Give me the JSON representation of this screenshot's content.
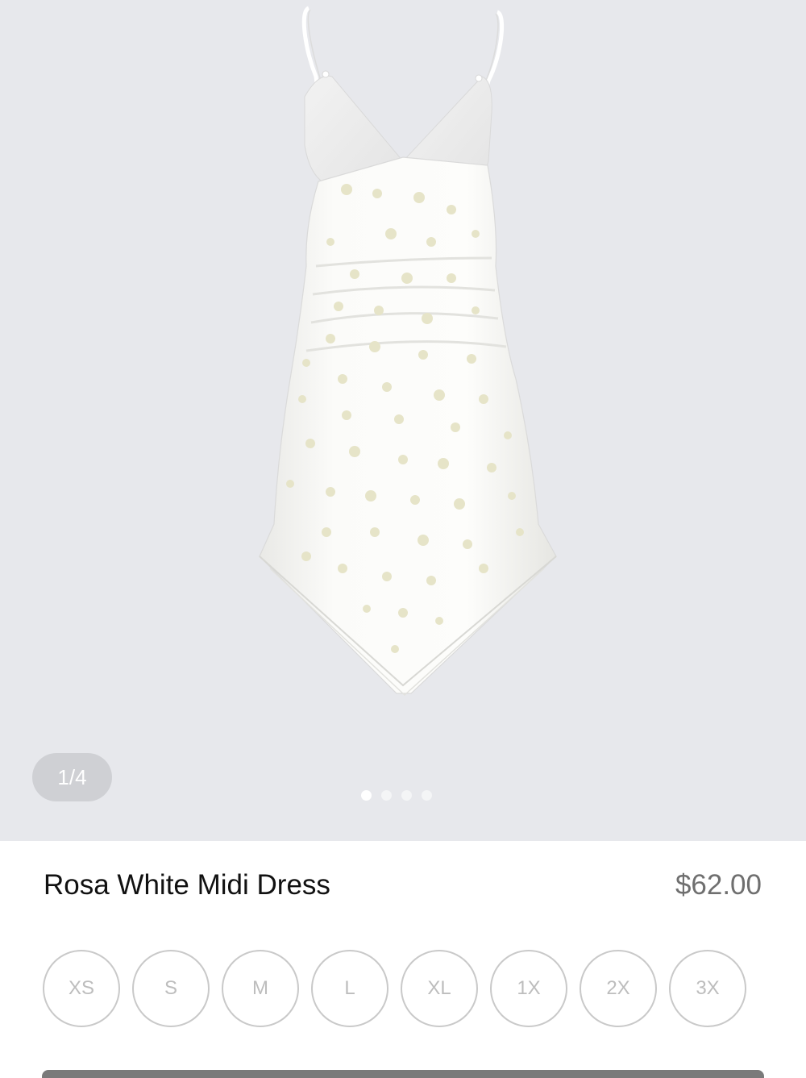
{
  "gallery": {
    "image_counter": "1/4",
    "total_images": 4,
    "active_index": 0
  },
  "product": {
    "title": "Rosa White Midi Dress",
    "price": "$62.00"
  },
  "sizes": [
    "XS",
    "S",
    "M",
    "L",
    "XL",
    "1X",
    "2X",
    "3X"
  ],
  "colors": {
    "gallery_background": "#e7e8ec",
    "dress": "#f8f8f6",
    "floral_print": "#e6e4c8",
    "size_border": "#c9c9c9",
    "size_text": "#bdbdbd"
  }
}
